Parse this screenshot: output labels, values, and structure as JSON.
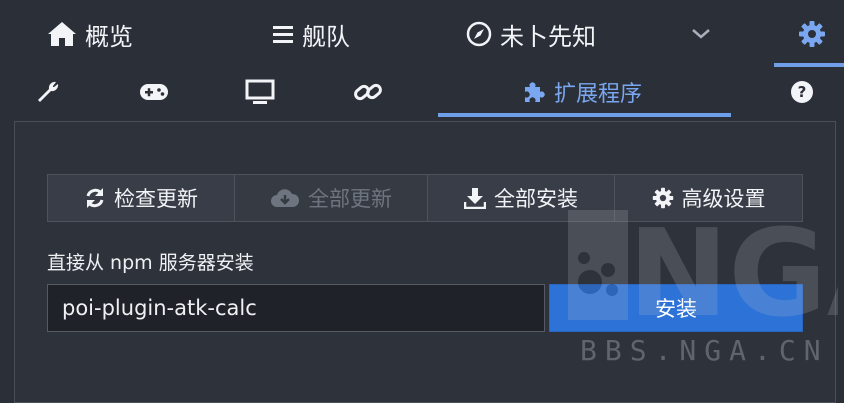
{
  "top_nav": {
    "tabs": [
      {
        "label": "概览",
        "icon": "home-icon"
      },
      {
        "label": "舰队",
        "icon": "list-icon"
      },
      {
        "label": "未卜先知",
        "icon": "compass-icon"
      },
      {
        "label": "",
        "icon": "chevron-down-icon"
      },
      {
        "label": "",
        "icon": "gear-icon",
        "active": true
      }
    ]
  },
  "sub_nav": {
    "tabs": [
      {
        "label": "",
        "icon": "wrench-icon"
      },
      {
        "label": "",
        "icon": "gamepad-icon"
      },
      {
        "label": "",
        "icon": "monitor-icon"
      },
      {
        "label": "",
        "icon": "link-icon"
      },
      {
        "label": "扩展程序",
        "icon": "puzzle-icon",
        "active": true
      },
      {
        "label": "",
        "icon": "help-icon"
      }
    ]
  },
  "plugin_panel": {
    "actions": [
      {
        "label": "检查更新",
        "icon": "refresh-icon",
        "enabled": true
      },
      {
        "label": "全部更新",
        "icon": "cloud-download-icon",
        "enabled": false
      },
      {
        "label": "全部安装",
        "icon": "download-icon",
        "enabled": true
      },
      {
        "label": "高级设置",
        "icon": "gear-icon",
        "enabled": true
      }
    ],
    "npm_label": "直接从 npm 服务器安装",
    "npm_input_value": "poi-plugin-atk-calc",
    "install_label": "安装"
  },
  "watermark": {
    "logo": "NGA",
    "text": "BBS.NGA.CN"
  },
  "colors": {
    "background": "#2b2f38",
    "accent": "#6f9fe8",
    "primary_button": "#2d72d6"
  }
}
